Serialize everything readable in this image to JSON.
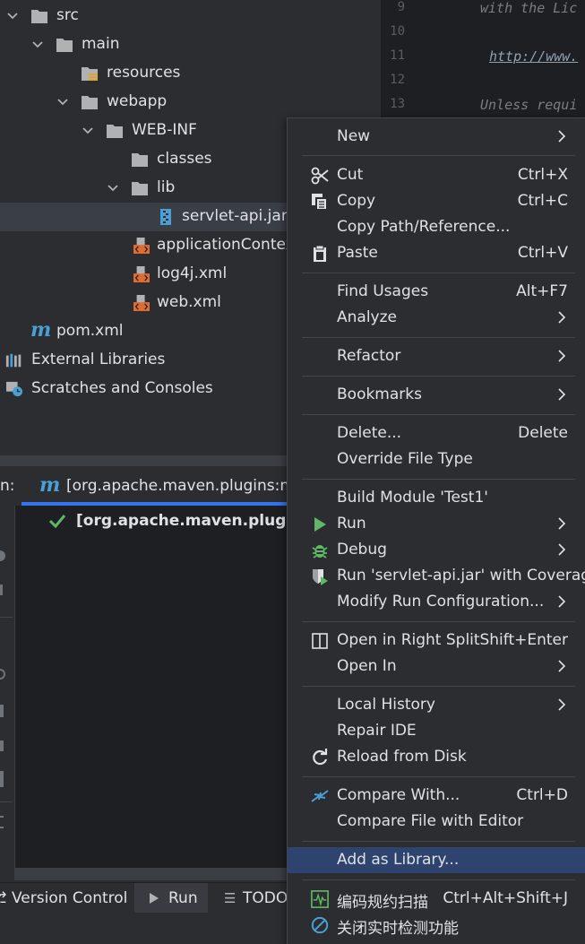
{
  "tree": {
    "rows": [
      {
        "label": "src",
        "icon": "folder-icon"
      },
      {
        "label": "main",
        "icon": "folder-icon"
      },
      {
        "label": "resources",
        "icon": "resources-folder-icon"
      },
      {
        "label": "webapp",
        "icon": "folder-icon"
      },
      {
        "label": "WEB-INF",
        "icon": "folder-icon"
      },
      {
        "label": "classes",
        "icon": "folder-icon"
      },
      {
        "label": "lib",
        "icon": "folder-icon"
      },
      {
        "label": "servlet-api.jar",
        "icon": "jar-icon"
      },
      {
        "label": "applicationContext",
        "icon": "xml-file-icon"
      },
      {
        "label": "log4j.xml",
        "icon": "xml-file-icon"
      },
      {
        "label": "web.xml",
        "icon": "xml-file-icon"
      },
      {
        "label": "pom.xml",
        "icon": "maven-icon"
      },
      {
        "label": "External Libraries",
        "icon": "libraries-icon"
      },
      {
        "label": "Scratches and Consoles",
        "icon": "scratches-icon"
      }
    ]
  },
  "editor": {
    "lines": [
      {
        "num": "9",
        "text": "with the Lic"
      },
      {
        "num": "10",
        "text": ""
      },
      {
        "num": "11",
        "text": "http://www."
      },
      {
        "num": "12",
        "text": ""
      },
      {
        "num": "13",
        "text": "Unless requi"
      }
    ]
  },
  "run": {
    "prefix": "n:",
    "tab_label": "[org.apache.maven.plugins:mav",
    "item_label": "[org.apache.maven.plugins:m"
  },
  "bottom": {
    "version_control": "Version Control",
    "run": "Run",
    "todo": "TODO"
  },
  "menu": {
    "new": "New",
    "cut": "Cut",
    "cut_sc": "Ctrl+X",
    "copy": "Copy",
    "copy_sc": "Ctrl+C",
    "copy_path": "Copy Path/Reference...",
    "paste": "Paste",
    "paste_sc": "Ctrl+V",
    "find_usages": "Find Usages",
    "find_usages_sc": "Alt+F7",
    "analyze": "Analyze",
    "refactor": "Refactor",
    "bookmarks": "Bookmarks",
    "delete": "Delete...",
    "delete_sc": "Delete",
    "override_type": "Override File Type",
    "build_module": "Build Module 'Test1'",
    "run": "Run",
    "debug": "Debug",
    "run_coverage": "Run 'servlet-api.jar' with Coverage",
    "modify_run": "Modify Run Configuration...",
    "open_right_split": "Open in Right Split",
    "open_right_split_sc": "Shift+Enter",
    "open_in": "Open In",
    "local_history": "Local History",
    "repair_ide": "Repair IDE",
    "reload": "Reload from Disk",
    "compare_with": "Compare With...",
    "compare_with_sc": "Ctrl+D",
    "compare_editor": "Compare File with Editor",
    "add_library": "Add as Library...",
    "code_scan": "编码规约扫描",
    "code_scan_sc": "Ctrl+Alt+Shift+J",
    "close_realtime": "关闭实时检测功能"
  },
  "colors": {
    "accent": "#3574f0",
    "selection": "#2e436e",
    "folder": "#afb1b3",
    "run_green": "#5fb865",
    "xml_orange": "#e06c2e",
    "maven_blue": "#4aa0d5"
  }
}
